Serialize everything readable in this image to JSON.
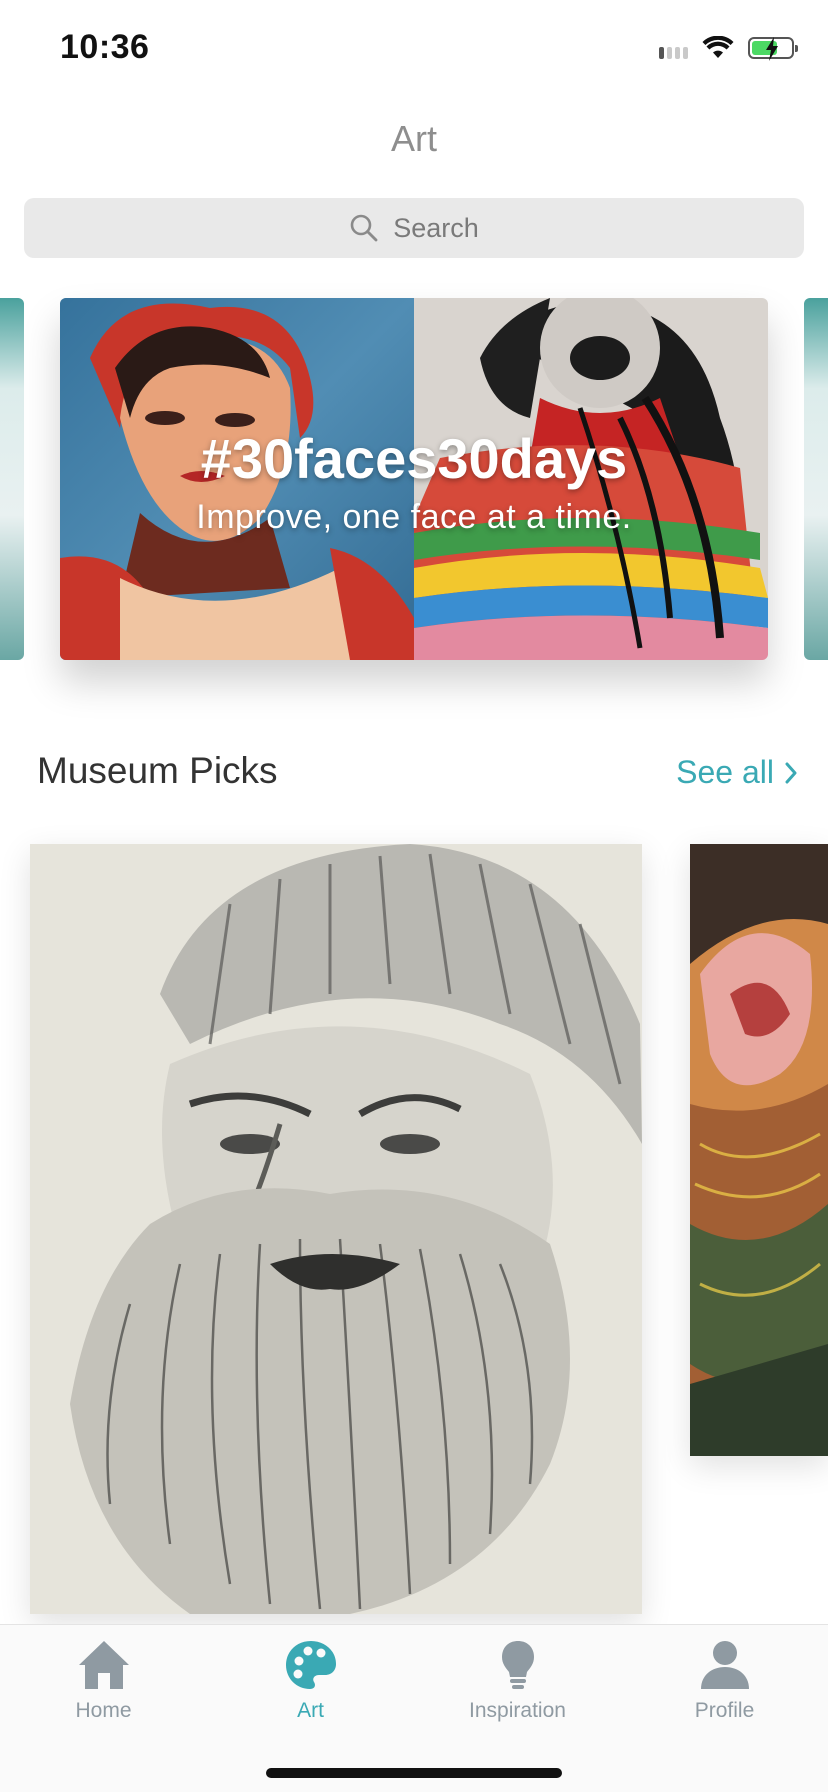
{
  "status_bar": {
    "time": "10:36",
    "icons": [
      "cellular-signal-icon",
      "wifi-icon",
      "battery-charging-icon"
    ],
    "battery_level": 0.65
  },
  "header": {
    "title": "Art"
  },
  "search": {
    "placeholder": "Search",
    "icon": "search-icon"
  },
  "banner": {
    "title": "#30faces30days",
    "subtitle": "Improve, one face at a time."
  },
  "museum_picks": {
    "title": "Museum Picks",
    "see_all_label": "See all",
    "see_all_icon": "chevron-right-icon"
  },
  "tab_bar": {
    "tabs": [
      {
        "label": "Home",
        "icon": "home-icon",
        "active": false
      },
      {
        "label": "Art",
        "icon": "palette-icon",
        "active": true
      },
      {
        "label": "Inspiration",
        "icon": "lightbulb-icon",
        "active": false
      },
      {
        "label": "Profile",
        "icon": "person-icon",
        "active": false
      }
    ]
  },
  "colors": {
    "accent": "#3aa9b4",
    "inactive_tab": "#8f9aa2",
    "title_gray": "#8e8e8e",
    "search_bg": "#e9e9e9"
  }
}
